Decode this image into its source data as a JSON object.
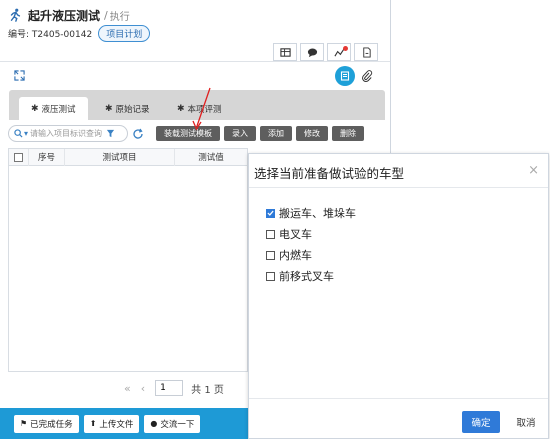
{
  "header": {
    "title": "起升液压测试",
    "separator": "/",
    "status": "执行",
    "code": "编号: T2405-00142",
    "plan_tag": "项目计划"
  },
  "tabs": [
    {
      "label": "液压测试"
    },
    {
      "label": "原始记录"
    },
    {
      "label": "本项评测"
    }
  ],
  "toolbar": {
    "search_placeholder": "请输入项目标识查询",
    "buttons": [
      "装载测试模板",
      "录入",
      "添加",
      "修改",
      "删除"
    ]
  },
  "table": {
    "columns": [
      "序号",
      "测试项目",
      "测试值"
    ]
  },
  "pager": {
    "page": "1",
    "total": "共 1 页"
  },
  "footer": {
    "buttons": [
      "已完成任务",
      "上传文件",
      "交流一下"
    ]
  },
  "modal": {
    "title": "选择当前准备做试验的车型",
    "close": "×",
    "options": [
      {
        "label": "搬运车、堆垛车",
        "checked": true
      },
      {
        "label": "电叉车",
        "checked": false
      },
      {
        "label": "内燃车",
        "checked": false
      },
      {
        "label": "前移式叉车",
        "checked": false
      }
    ],
    "ok": "确定",
    "cancel": "取消"
  },
  "colors": {
    "accent": "#1e9ad6",
    "primary": "#2f7ad8",
    "dark_button": "#5e5e5e",
    "annotation": "#e02020"
  }
}
